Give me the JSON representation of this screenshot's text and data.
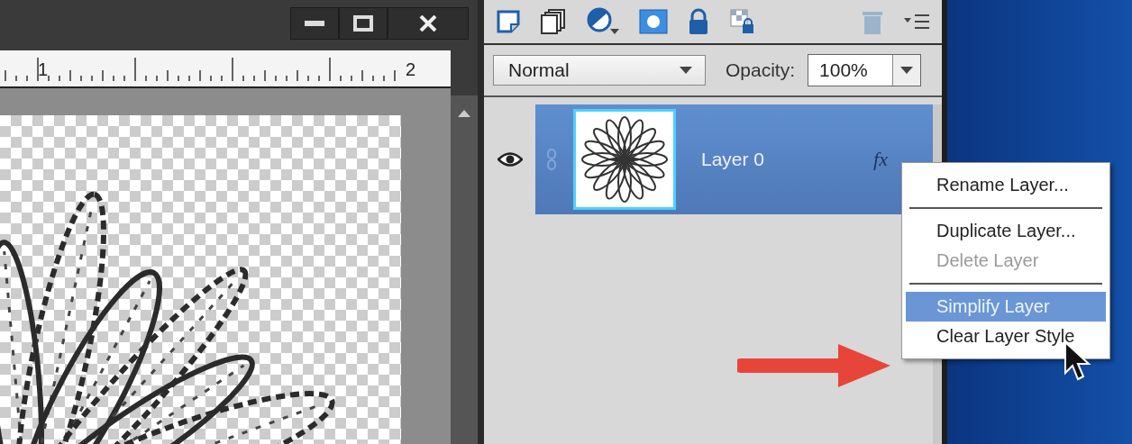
{
  "document": {
    "ruler_labels": [
      "1",
      "2"
    ]
  },
  "layers_panel": {
    "blend_mode": "Normal",
    "opacity_label": "Opacity:",
    "opacity": "100%",
    "layers": [
      {
        "name": "Layer 0",
        "fx": "fx",
        "selected": true,
        "visible": true
      }
    ]
  },
  "context_menu": {
    "items": [
      {
        "label": "Rename Layer...",
        "disabled": false,
        "selected": false,
        "separator_after": true
      },
      {
        "label": "Duplicate Layer...",
        "disabled": false,
        "selected": false,
        "separator_after": false
      },
      {
        "label": "Delete Layer",
        "disabled": true,
        "selected": false,
        "separator_after": true
      },
      {
        "label": "Simplify Layer",
        "disabled": false,
        "selected": true,
        "separator_after": false
      },
      {
        "label": "Clear Layer Style",
        "disabled": false,
        "selected": false,
        "separator_after": false
      }
    ]
  }
}
